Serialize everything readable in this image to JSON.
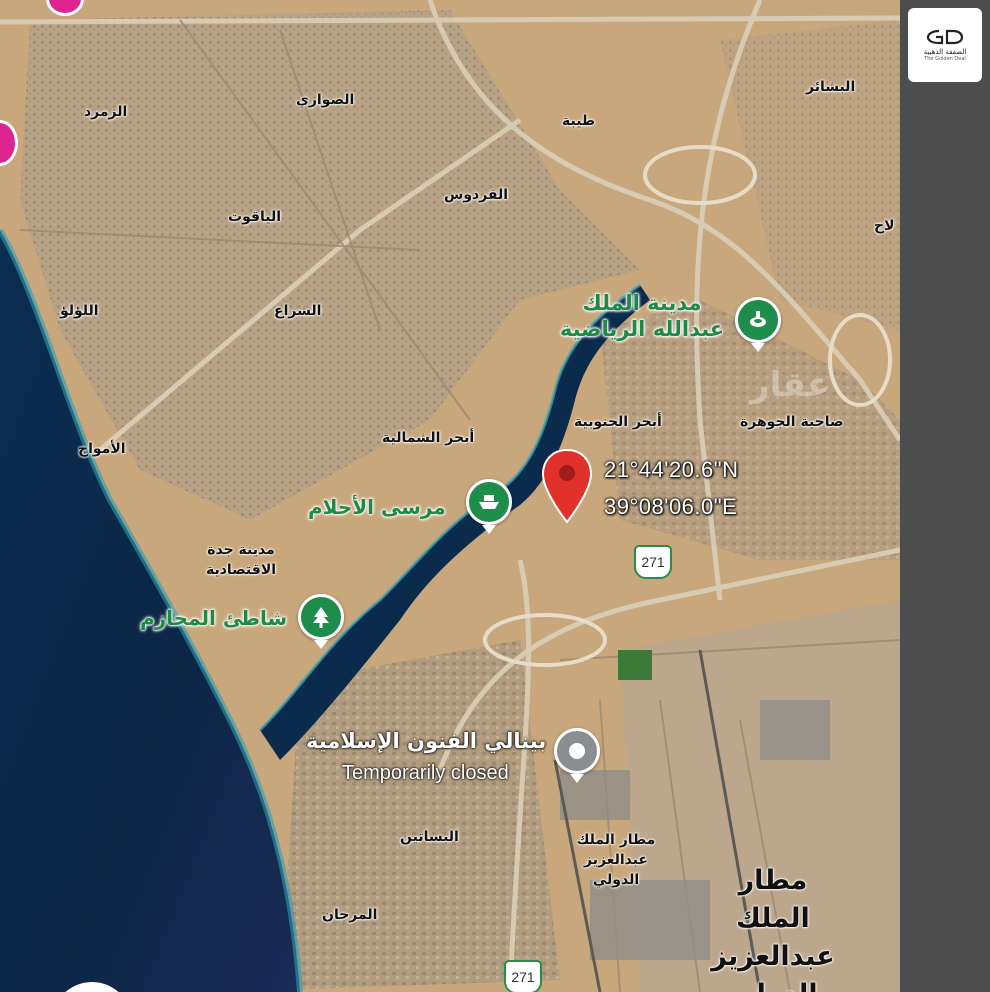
{
  "map": {
    "labels": {
      "zumurrud": "الزمرد",
      "sawari": "الصواري",
      "tayba": "طيبة",
      "bashaer": "البشائر",
      "firdaws": "الفردوس",
      "yaqoot": "الياقوت",
      "loloo": "اللؤلؤ",
      "shiraa": "الشراع",
      "amwaj": "الأمواج",
      "abhur_north": "أبحر الشمالية",
      "abhur_south": "أبحر الجنوبية",
      "jawhara": "ضاحية الجوهرة",
      "jeddah_econ_city": "مدينة جدة الاقتصادية",
      "basateen": "البساتين",
      "murjan": "المرجان",
      "airport_small": "مطار الملك عبدالعزيز الدولي",
      "edge_label": "لاح"
    },
    "places": {
      "sports_city": "مدينة الملك عبدالله الرياضية",
      "marsa": "مرسى الأحلام",
      "hazem_beach": "شاطئ المحازم",
      "biennale_name": "بينالي الفنون الإسلامية",
      "biennale_status": "Temporarily closed",
      "airport_big": "مطار الملك عبدالعزيز الدولي"
    },
    "pin": {
      "lat": "21°44'20.6\"N",
      "lng": "39°08'06.0\"E",
      "color": "#e0322b"
    },
    "road_shields": [
      "271",
      "271"
    ],
    "watermark": "عقار"
  },
  "icons": {
    "sports": "stadium-icon",
    "marina": "boat-icon",
    "beach": "tree-icon",
    "biennale": "gray-place-icon",
    "pin": "location-pin-icon"
  },
  "logo": {
    "arabic": "الصفقة الذهبية",
    "english": "The Golden Deal"
  },
  "colors": {
    "sea": "#0b2f52",
    "land": "#c9a77c",
    "poi_green": "#1e8d4b"
  }
}
